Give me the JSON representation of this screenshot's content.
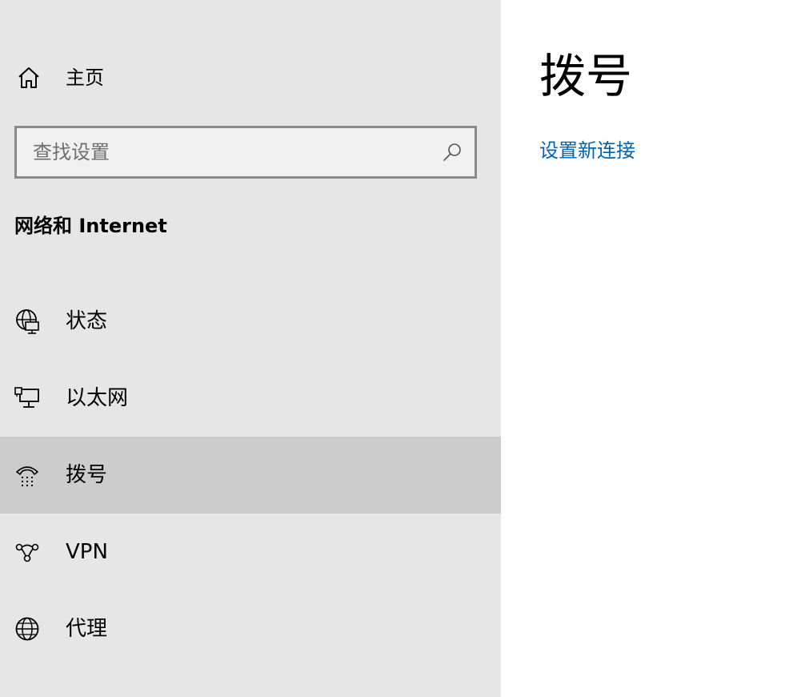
{
  "sidebar": {
    "home": {
      "label": "主页",
      "icon": "home-icon"
    },
    "search": {
      "placeholder": "查找设置",
      "value": "",
      "icon": "search-icon"
    },
    "section_title": "网络和 Internet",
    "items": [
      {
        "label": "状态",
        "icon": "globe-monitor-icon",
        "selected": false
      },
      {
        "label": "以太网",
        "icon": "ethernet-icon",
        "selected": false
      },
      {
        "label": "拨号",
        "icon": "dialup-phone-icon",
        "selected": true
      },
      {
        "label": "VPN",
        "icon": "vpn-icon",
        "selected": false
      },
      {
        "label": "代理",
        "icon": "globe-icon",
        "selected": false
      }
    ]
  },
  "main": {
    "title": "拨号",
    "link": "设置新连接"
  },
  "colors": {
    "sidebar_bg": "#e6e6e6",
    "selected_bg": "#cccccc",
    "link": "#0063b1",
    "search_border": "#8a8a8a"
  }
}
